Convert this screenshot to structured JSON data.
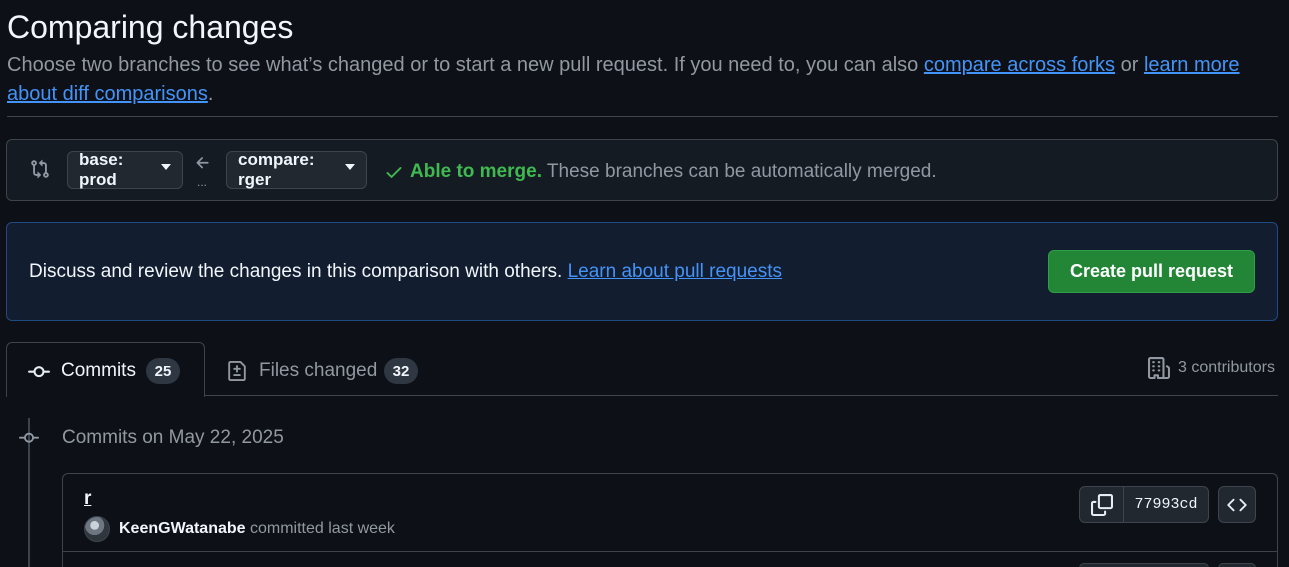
{
  "header": {
    "title": "Comparing changes",
    "subtitle_prefix": "Choose two branches to see what’s changed or to start a new pull request. If you need to, you can also ",
    "link_forks": "compare across forks",
    "subtitle_mid": " or ",
    "link_diff": "learn more about diff comparisons",
    "subtitle_suffix": "."
  },
  "range": {
    "base_label": "base: prod",
    "compare_label": "compare: rger",
    "dots": "...",
    "merge_ok": "Able to merge.",
    "merge_text": " These branches can be automatically merged."
  },
  "flash": {
    "text": "Discuss and review the changes in this comparison with others. ",
    "link": "Learn about pull requests",
    "button": "Create pull request"
  },
  "tabs": [
    {
      "label": "Commits",
      "count": "25",
      "icon": "git-commit-icon",
      "active": true
    },
    {
      "label": "Files changed",
      "count": "32",
      "icon": "file-diff-icon",
      "active": false
    }
  ],
  "contributors": {
    "text": "3 contributors",
    "icon": "organization-icon"
  },
  "timeline": {
    "group_title": "Commits on May 22, 2025",
    "commits": [
      {
        "message": "r",
        "author": "KeenGWatanabe",
        "action": " committed last week",
        "sha": "77993cd"
      }
    ]
  },
  "colors": {
    "background": "#0d1117",
    "accent_link": "#4493f8",
    "success": "#3fb950",
    "primary_button": "#238636",
    "flash_bg": "#121d2f",
    "border": "#3d444d"
  }
}
